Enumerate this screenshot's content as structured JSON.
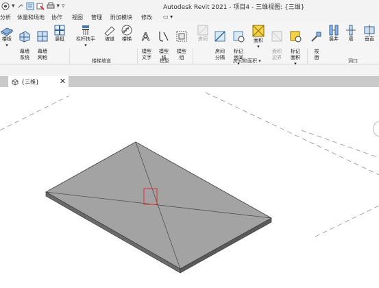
{
  "window": {
    "title": "Autodesk Revit 2021 - 项目4 - 三维视图: {三维}",
    "qat_icons": [
      "revit-logo-icon",
      "undo-icon",
      "redo-icon",
      "measure-icon",
      "close-hidden-icon",
      "print-icon",
      "customize-icon"
    ]
  },
  "menu": {
    "items": [
      "分析",
      "体量和场地",
      "协作",
      "视图",
      "管理",
      "附加模块",
      "修改",
      "▭ ▾"
    ]
  },
  "ribbon": {
    "buttons": [
      {
        "id": "floor",
        "label": "楼板"
      },
      {
        "id": "curtain-system",
        "label": "幕墙\n系统"
      },
      {
        "id": "curtain-grid",
        "label": "幕墙\n网格"
      },
      {
        "id": "mullion",
        "label": "竖梃"
      },
      {
        "id": "railing",
        "label": "栏杆扶手"
      },
      {
        "id": "ramp",
        "label": "坡道"
      },
      {
        "id": "stair",
        "label": "楼梯"
      },
      {
        "id": "model-text",
        "label": "模型\n文字"
      },
      {
        "id": "model-line",
        "label": "模型\n线"
      },
      {
        "id": "model-group",
        "label": "模型\n组"
      },
      {
        "id": "room",
        "label": "房间"
      },
      {
        "id": "room-separator",
        "label": "房间\n分隔"
      },
      {
        "id": "tag-room",
        "label": "标记\n房间"
      },
      {
        "id": "area",
        "label": "面积"
      },
      {
        "id": "area-boundary",
        "label": "面积\n边界"
      },
      {
        "id": "tag-area",
        "label": "标记\n面积"
      },
      {
        "id": "by-face",
        "label": "按\n面"
      },
      {
        "id": "shaft",
        "label": "竖井"
      },
      {
        "id": "wall-opening",
        "label": "墙"
      },
      {
        "id": "vertical-opening",
        "label": "垂直"
      }
    ],
    "groups": [
      {
        "id": "stair-ramp",
        "label": "楼梯坡道"
      },
      {
        "id": "model",
        "label": "模型"
      },
      {
        "id": "room-area",
        "label": "房间和面积 ▾"
      },
      {
        "id": "opening",
        "label": "洞口"
      }
    ]
  },
  "view_tab": {
    "icon": "3d-view-icon",
    "label": "{三维}",
    "close": "✕"
  },
  "viewport": {
    "model": "floor-slab",
    "bg": "#ffffff",
    "slab_top": "#a3a3a3",
    "slab_edge": "#5a5a5a",
    "selection_color": "#e03030"
  }
}
